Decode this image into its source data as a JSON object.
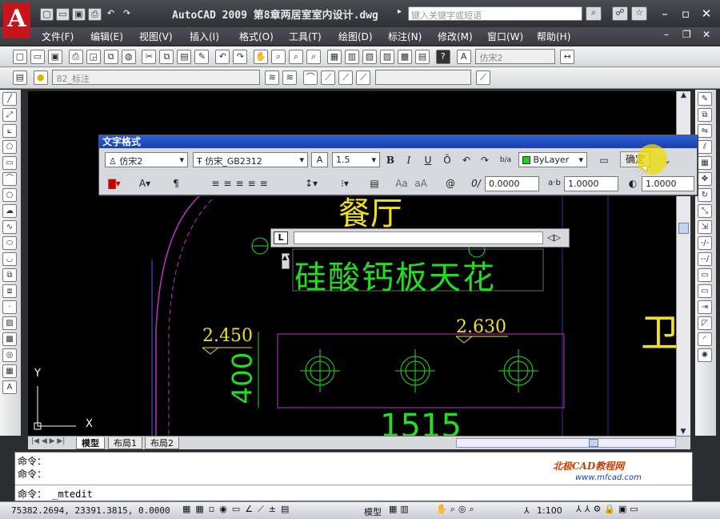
{
  "app": {
    "title": "AutoCAD 2009  第8章两居室室内设计.dwg",
    "search_placeholder": "键入关键字或短语"
  },
  "menu": [
    "文件(F)",
    "编辑(E)",
    "视图(V)",
    "插入(I)",
    "格式(O)",
    "工具(T)",
    "绘图(D)",
    "标注(N)",
    "修改(M)",
    "窗口(W)",
    "帮助(H)"
  ],
  "toolbar": {
    "text_style": "仿宋2",
    "layer": "82_标注"
  },
  "text_format": {
    "title": "文字格式",
    "style": "仿宋2",
    "font": "仿宋_GB2312",
    "height": "1.5",
    "color": "ByLayer",
    "ok": "确定",
    "oblique": "0.0000",
    "tracking": "1.0000",
    "width_factor": "1.0000",
    "bold": "B",
    "italic": "I",
    "underline": "U",
    "overline": "Ō",
    "stack": "b/a",
    "upper": "Aa",
    "lower": "aA",
    "at": "@"
  },
  "drawing": {
    "label_dining": "餐厅",
    "label_ceiling": "硅酸钙板天花",
    "elev1": "2.450",
    "elev2": "2.630",
    "dim_400": "400",
    "dim_1515": "1515",
    "wei": "卫",
    "axis_x": "X",
    "axis_y": "Y"
  },
  "tabs": [
    "模型",
    "布局1",
    "布局2"
  ],
  "command": {
    "lines": [
      "命令：",
      "命令："
    ],
    "prompt": "命令：  _mtedit"
  },
  "status": {
    "coords": "75382.2694, 23391.3815, 0.0000",
    "model": "模型",
    "scale": "1:100"
  },
  "watermark": {
    "brand": "北极CAD教程网",
    "url": "www.mfcad.com"
  },
  "colors": {
    "accent": "#1b3fa8",
    "drawing_bg": "#000000",
    "green": "#22dd22",
    "yellow": "#f0e020",
    "magenta": "#c030c0"
  }
}
